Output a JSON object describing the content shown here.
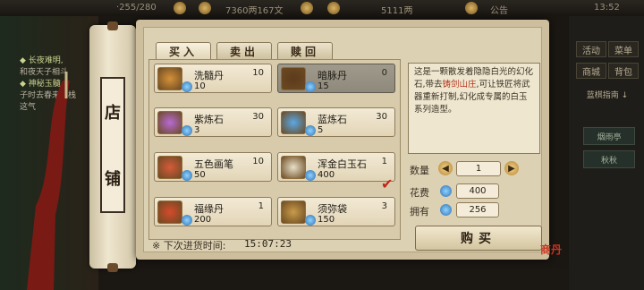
{
  "topbar": {
    "stat1": "·255/280",
    "money": "7360两167文",
    "gold": "5111两",
    "notice": "公告",
    "time": "13:52"
  },
  "quests": [
    "◆ 长夜难明,",
    "和夜天子相斗",
    "◆ 神秘玉髓",
    "子时去春来客栈",
    "这气"
  ],
  "right_panel": {
    "btn1": "活动",
    "btn2": "菜单",
    "btn3": "商城",
    "btn4": "背包",
    "hint": "蓝棋指南 ↓",
    "side1": "烟雨亭",
    "side2": "秋秋"
  },
  "shop": {
    "sign_char1": "店",
    "sign_char2": "铺",
    "tabs": [
      "买入",
      "卖出",
      "赎回"
    ],
    "items": [
      {
        "name": "洗髓丹",
        "qty": "10",
        "price": "10",
        "color": "#d6913a"
      },
      {
        "name": "暗脉丹",
        "qty": "0",
        "price": "15",
        "color": "#5d3b1c"
      },
      {
        "name": "紫炼石",
        "qty": "30",
        "price": "3",
        "color": "#b76ad6"
      },
      {
        "name": "蓝炼石",
        "qty": "30",
        "price": "5",
        "color": "#5aa8e6"
      },
      {
        "name": "五色画笔",
        "qty": "10",
        "price": "50",
        "color": "#d65a3a"
      },
      {
        "name": "浑金白玉石",
        "qty": "1",
        "price": "400",
        "color": "#e8e0c8"
      },
      {
        "name": "福缘丹",
        "qty": "1",
        "price": "200",
        "color": "#d64a2c"
      },
      {
        "name": "须弥袋",
        "qty": "3",
        "price": "150",
        "color": "#c99b4a"
      }
    ],
    "restock_label": "※ 下次进货时间:",
    "restock_time": "15:07:23",
    "desc_a": "这是一颗散发着隐隐白光的幻化石,带去",
    "desc_hl": "铸剑山庄",
    "desc_b": ",可让铁匠将武器重新打制,幻化成专属的白玉系列造型。",
    "qty_label": "数量",
    "qty_value": "1",
    "cost_label": "花费",
    "cost_value": "400",
    "own_label": "拥有",
    "own_value": "256",
    "buy_label": "购买",
    "stamp": "商丹"
  }
}
